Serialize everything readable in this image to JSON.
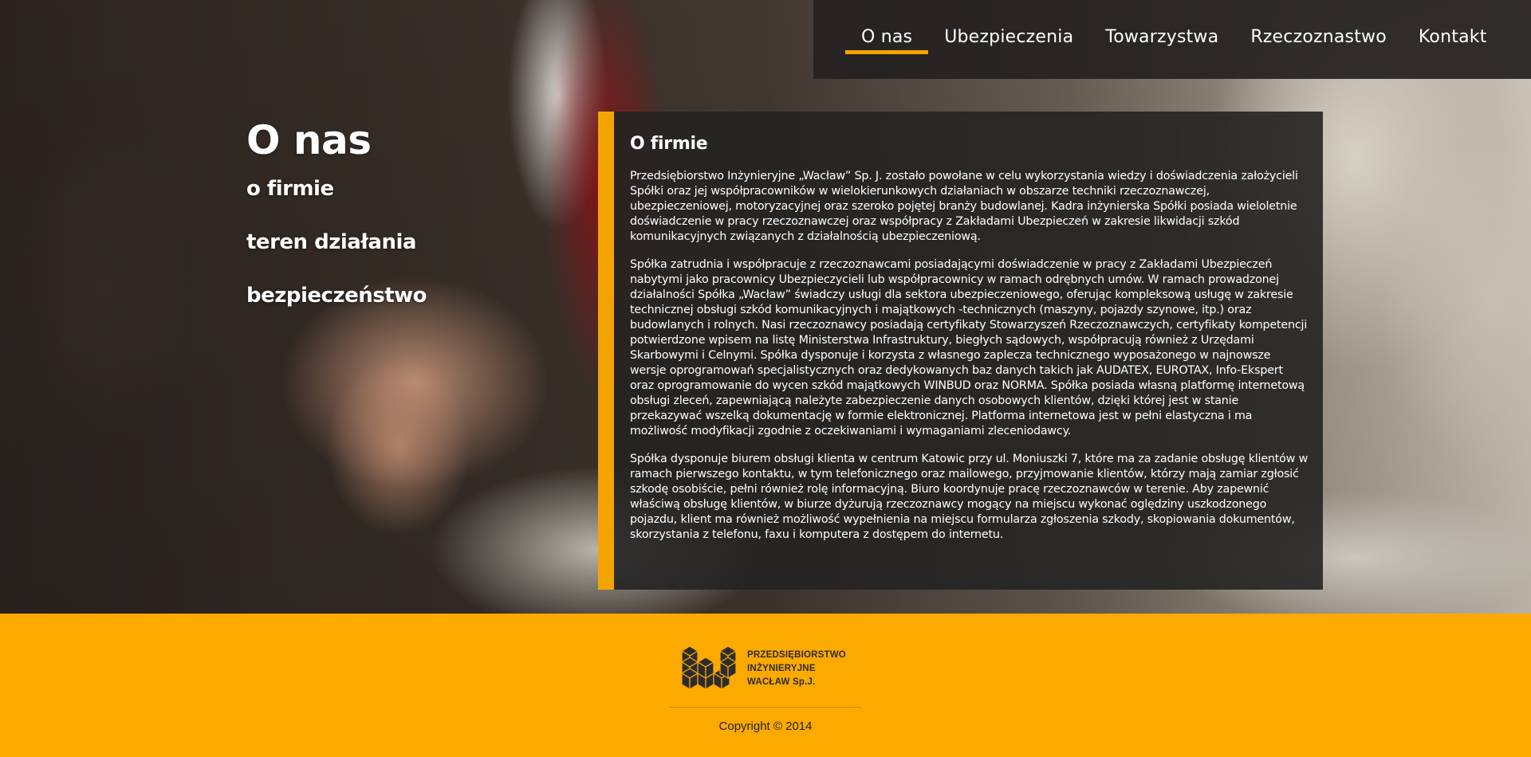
{
  "nav": {
    "items": [
      {
        "label": "O nas",
        "active": true
      },
      {
        "label": "Ubezpieczenia",
        "active": false
      },
      {
        "label": "Towarzystwa",
        "active": false
      },
      {
        "label": "Rzeczoznastwo",
        "active": false
      },
      {
        "label": "Kontakt",
        "active": false
      }
    ]
  },
  "sidebar": {
    "title": "O nas",
    "links": [
      "o firmie",
      "teren działania",
      "bezpieczeństwo"
    ]
  },
  "content": {
    "title": "O firmie",
    "paragraphs": [
      "Przedsiębiorstwo Inżynieryjne „Wacław” Sp. J. zostało powołane w celu wykorzystania wiedzy i doświadczenia założycieli Spółki oraz jej współpracowników w wielokierunkowych działaniach w obszarze techniki rzeczoznawczej, ubezpieczeniowej, motoryzacyjnej oraz szeroko pojętej branży budowlanej. Kadra inżynierska Spółki posiada wieloletnie doświadczenie w pracy rzeczoznawczej oraz współpracy z Zakładami Ubezpieczeń w zakresie likwidacji szkód komunikacyjnych związanych z działalnością ubezpieczeniową.",
      "Spółka zatrudnia i współpracuje z rzeczoznawcami posiadającymi doświadczenie w pracy z Zakładami Ubezpieczeń nabytymi jako pracownicy Ubezpieczycieli lub współpracownicy w ramach odrębnych umów. W ramach prowadzonej działalności Spółka „Wacław” świadczy usługi dla sektora ubezpieczeniowego, oferując kompleksową usługę w zakresie technicznej obsługi szkód komunikacyjnych i majątkowych -technicznych (maszyny, pojazdy szynowe, itp.) oraz budowlanych i rolnych. Nasi rzeczoznawcy posiadają certyfikaty Stowarzyszeń Rzeczoznawczych, certyfikaty kompetencji potwierdzone wpisem na listę Ministerstwa Infrastruktury, biegłych sądowych, współpracują również z Urzędami Skarbowymi i Celnymi. Spółka dysponuje i korzysta z własnego zaplecza technicznego wyposażonego w najnowsze wersje oprogramowań specjalistycznych oraz dedykowanych baz danych takich jak AUDATEX, EUROTAX, Info-Ekspert oraz oprogramowanie do wycen szkód majątkowych WINBUD oraz NORMA. Spółka posiada własną platformę internetową obsługi zleceń, zapewniającą należyte zabezpieczenie danych osobowych klientów, dzięki której jest w stanie przekazywać wszelką dokumentację w formie elektronicznej. Platforma internetowa jest w pełni elastyczna i ma możliwość modyfikacji zgodnie z oczekiwaniami i wymaganiami zleceniodawcy.",
      "Spółka dysponuje biurem obsługi klienta w centrum Katowic przy ul. Moniuszki 7, które ma za zadanie obsługę klientów w ramach pierwszego kontaktu, w tym telefonicznego oraz mailowego, przyjmowanie klientów, którzy mają zamiar zgłosić szkodę osobiście, pełni również rolę informacyjną. Biuro koordynuje pracę rzeczoznawców w terenie. Aby zapewnić właściwą obsługę klientów, w biurze dyżurują rzeczoznawcy mogący na miejscu wykonać oględziny uszkodzonego pojazdu, klient ma również możliwość wypełnienia na miejscu formularza zgłoszenia szkody, skopiowania dokumentów, skorzystania z telefonu, faxu i komputera z dostępem do internetu."
    ]
  },
  "footer": {
    "logo_lines": [
      "PRZEDSIĘBIORSTWO",
      "INŻYNIERYJNE",
      "WACŁAW Sp.J."
    ],
    "copyright": "Copyright © 2014"
  },
  "colors": {
    "accent": "#f4a400",
    "footer_bg": "#fcaa00",
    "panel_bg": "#252322"
  }
}
